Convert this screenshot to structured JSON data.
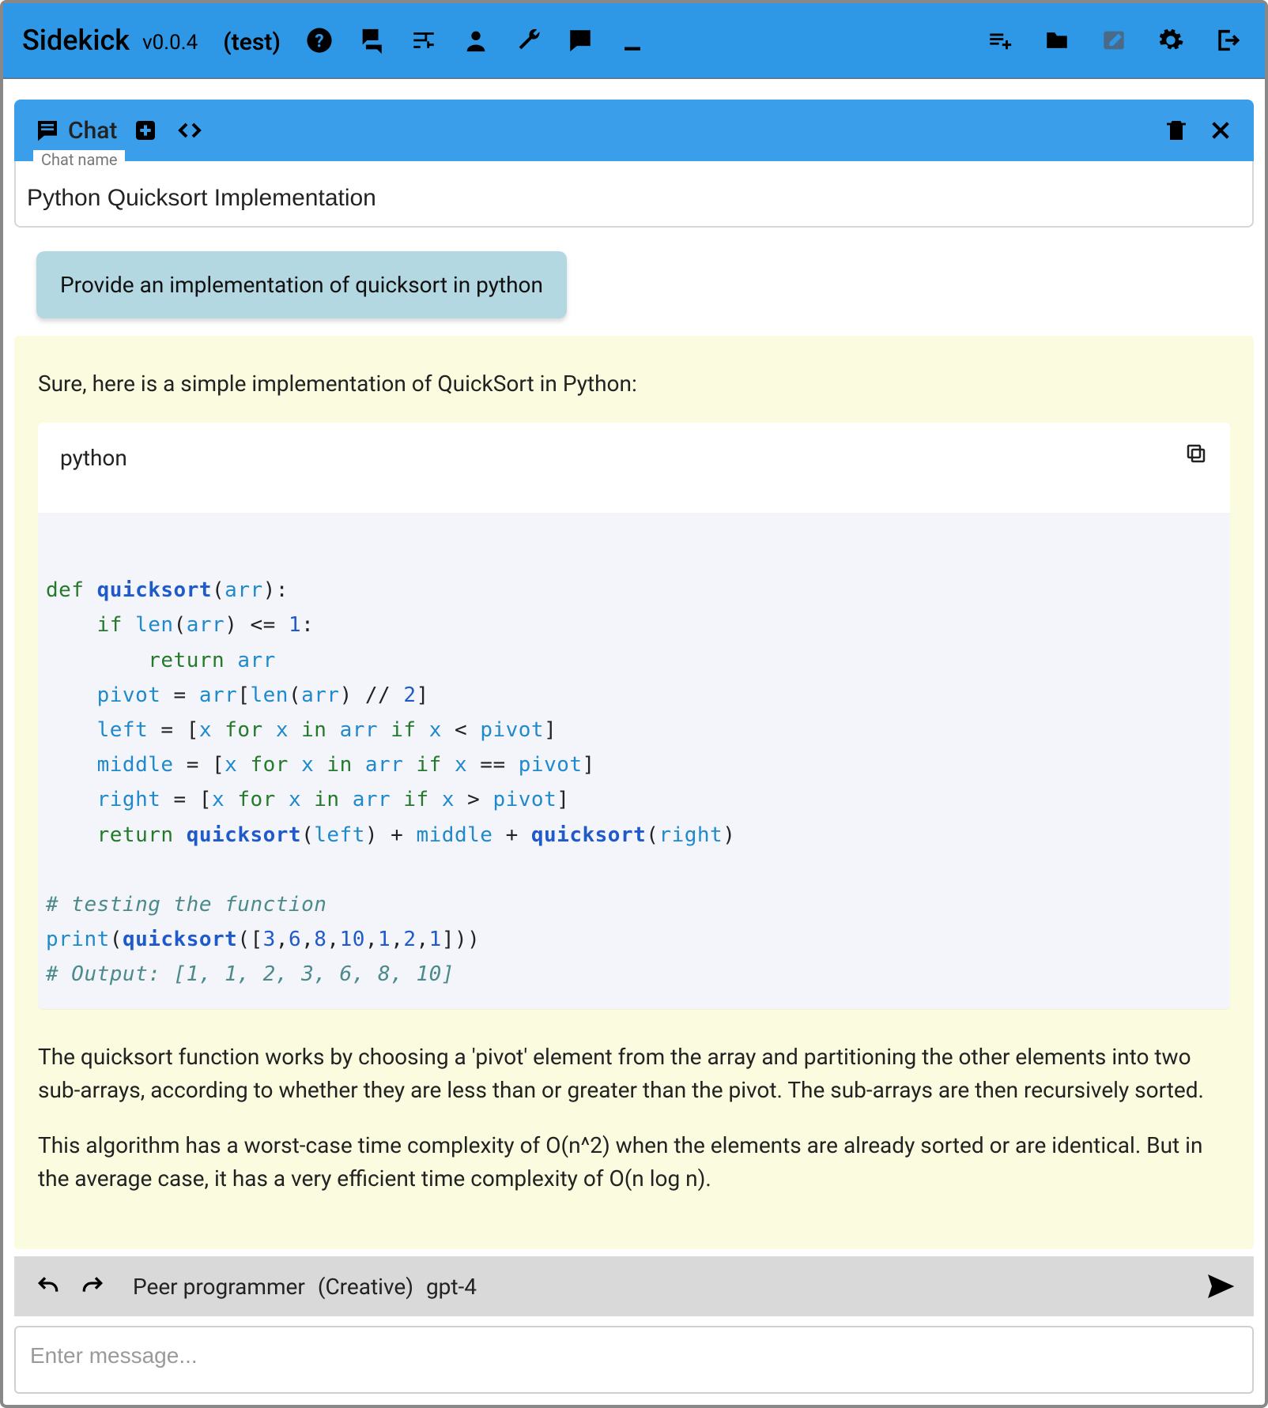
{
  "app": {
    "name": "Sidekick",
    "version": "v0.0.4",
    "env": "(test)"
  },
  "chatHeader": {
    "label": "Chat"
  },
  "chatNameField": {
    "legend": "Chat name",
    "value": "Python Quicksort Implementation"
  },
  "conversation": {
    "userMessage": "Provide an implementation of quicksort in python",
    "assistant": {
      "intro": "Sure, here is a simple implementation of QuickSort in Python:",
      "codeLang": "python",
      "code": {
        "lines": [
          "",
          "def quicksort(arr):",
          "    if len(arr) <= 1:",
          "        return arr",
          "    pivot = arr[len(arr) // 2]",
          "    left = [x for x in arr if x < pivot]",
          "    middle = [x for x in arr if x == pivot]",
          "    right = [x for x in arr if x > pivot]",
          "    return quicksort(left) + middle + quicksort(right)",
          "",
          "# testing the function",
          "print(quicksort([3,6,8,10,1,2,1]))",
          "# Output: [1, 1, 2, 3, 6, 8, 10]"
        ]
      },
      "para1": "The quicksort function works by choosing a 'pivot' element from the array and partitioning the other elements into two sub-arrays, according to whether they are less than or greater than the pivot. The sub-arrays are then recursively sorted.",
      "para2": "This algorithm has a worst-case time complexity of O(n^2) when the elements are already sorted or are identical. But in the average case, it has a very efficient time complexity of O(n log n)."
    }
  },
  "footer": {
    "persona": "Peer programmer",
    "mode": "(Creative)",
    "model": "gpt-4"
  },
  "composer": {
    "placeholder": "Enter message..."
  }
}
